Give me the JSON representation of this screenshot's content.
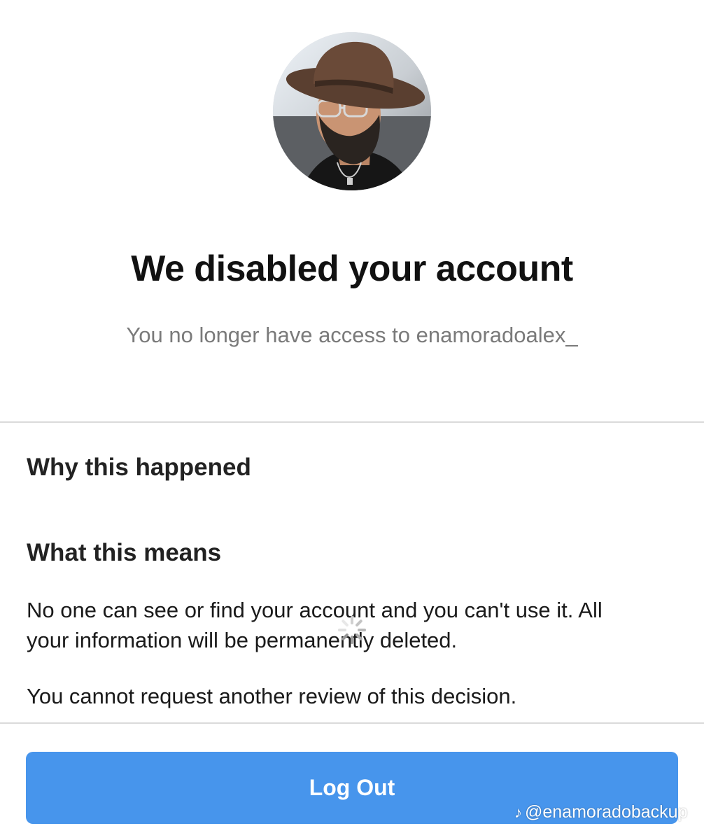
{
  "profile": {
    "avatar_icon": "profile-photo"
  },
  "header": {
    "title": "We disabled your account",
    "subtitle": "You no longer have access to enamoradoalex_"
  },
  "sections": {
    "why": {
      "heading": "Why this happened"
    },
    "means": {
      "heading": "What this means",
      "paragraph1_line1": "No one can see or find your account and you can't use it. All",
      "paragraph1_line2": "your information will be permanently deleted.",
      "paragraph2": "You cannot request another review of this decision."
    }
  },
  "actions": {
    "logout_label": "Log Out"
  },
  "watermark": {
    "icon": "tiktok-icon",
    "handle": "@enamoradobackup"
  },
  "colors": {
    "button_blue": "#4795ec",
    "subtitle_gray": "#7a7a7a",
    "divider": "#dadada"
  }
}
